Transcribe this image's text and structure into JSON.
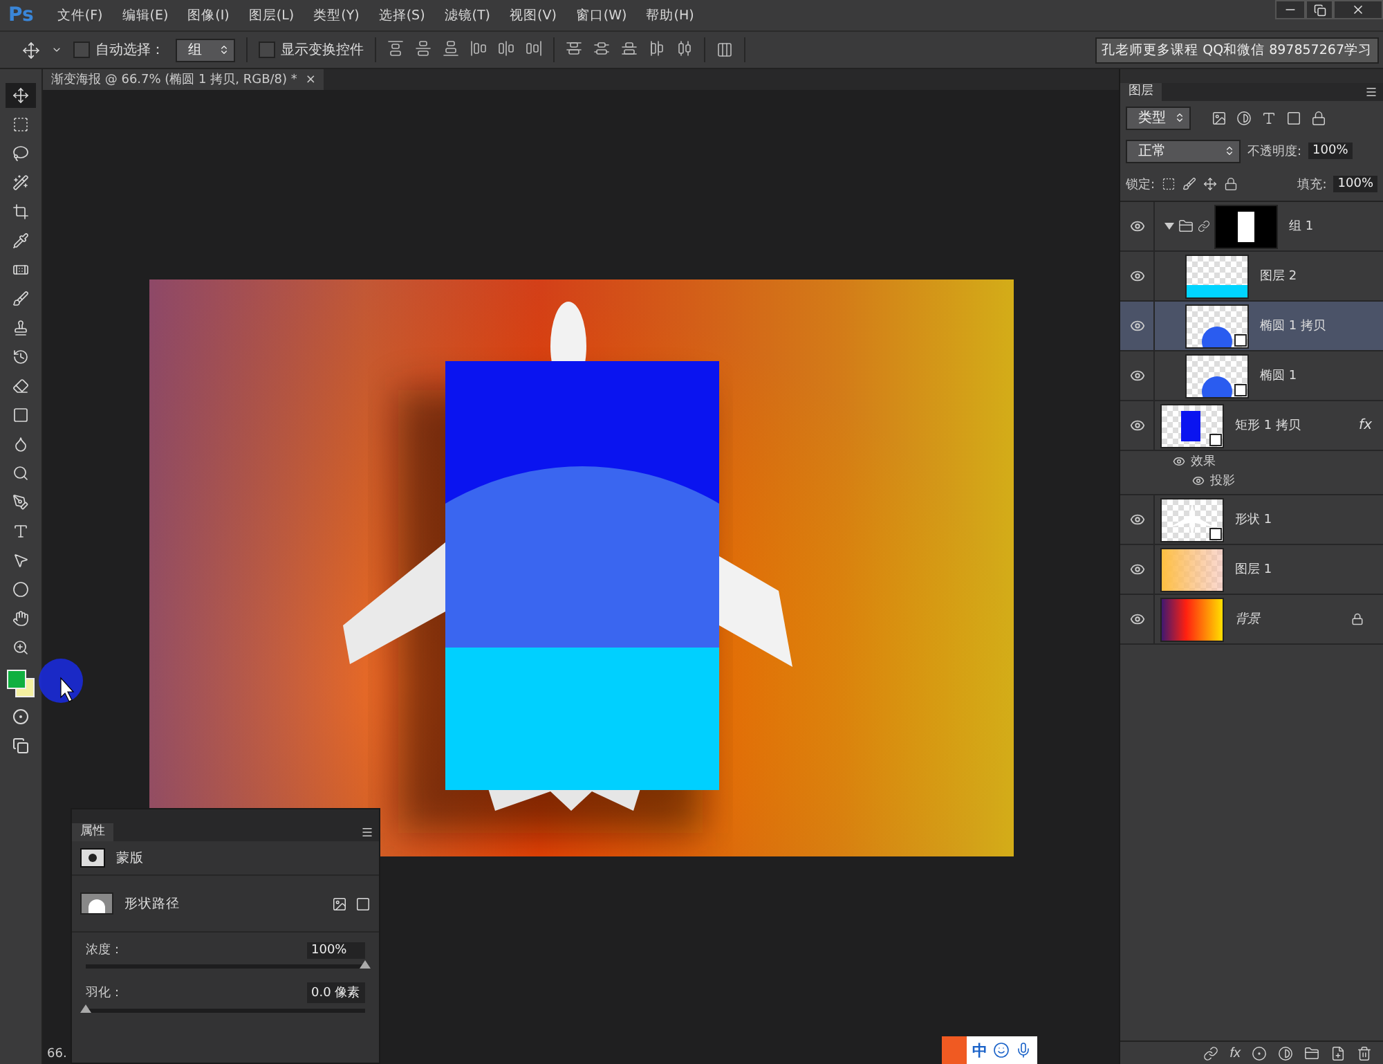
{
  "app_logo": "Ps",
  "menu": [
    "文件(F)",
    "编辑(E)",
    "图像(I)",
    "图层(L)",
    "类型(Y)",
    "选择(S)",
    "滤镜(T)",
    "视图(V)",
    "窗口(W)",
    "帮助(H)"
  ],
  "options": {
    "auto_select": {
      "label": "自动选择：",
      "checked": false
    },
    "target": "组",
    "show_transform": {
      "label": "显示变换控件",
      "checked": false
    },
    "banner": "孔老师更多课程 QQ和微信 897857267学习"
  },
  "tools": [
    {
      "kind": "move",
      "selected": true
    },
    {
      "kind": "marquee",
      "selected": false
    },
    {
      "kind": "lasso",
      "selected": false
    },
    {
      "kind": "quick-select",
      "selected": false
    },
    {
      "kind": "crop",
      "selected": false
    },
    {
      "kind": "eyedropper",
      "selected": false
    },
    {
      "kind": "healing",
      "selected": false
    },
    {
      "kind": "brush",
      "selected": false
    },
    {
      "kind": "stamp",
      "selected": false
    },
    {
      "kind": "history-brush",
      "selected": false
    },
    {
      "kind": "eraser",
      "selected": false
    },
    {
      "kind": "gradient",
      "selected": false
    },
    {
      "kind": "blur",
      "selected": false
    },
    {
      "kind": "dodge",
      "selected": false
    },
    {
      "kind": "pen",
      "selected": false
    },
    {
      "kind": "type",
      "selected": false
    },
    {
      "kind": "path-select",
      "selected": false
    },
    {
      "kind": "ellipse",
      "selected": false
    },
    {
      "kind": "hand",
      "selected": false
    },
    {
      "kind": "zoom",
      "selected": false
    }
  ],
  "document_tab": {
    "title": "渐变海报 @ 66.7% (椭圆 1 拷贝, RGB/8) *",
    "close": "×"
  },
  "status": "66.",
  "layers_panel": {
    "tab": "图层",
    "filter": "类型",
    "blend_mode": "正常",
    "opacity_label": "不透明度:",
    "opacity": "100%",
    "lock_label": "锁定:",
    "fill_label": "填充:",
    "fill": "100%",
    "footer_fx": "fx",
    "layers": [
      {
        "name": "组 1",
        "kind": "group",
        "visible": true,
        "selected": false,
        "expanded": true,
        "children": [
          {
            "name": "图层 2",
            "kind": "layer",
            "visible": true,
            "selected": false
          },
          {
            "name": "椭圆 1 拷贝",
            "kind": "shape",
            "visible": true,
            "selected": true
          },
          {
            "name": "椭圆 1",
            "kind": "shape",
            "visible": true,
            "selected": false
          }
        ]
      },
      {
        "name": "矩形 1 拷贝",
        "kind": "shape",
        "visible": true,
        "selected": false,
        "fx": "fx",
        "effects": {
          "label": "效果",
          "visible": true,
          "children": [
            {
              "label": "投影",
              "visible": true
            }
          ]
        }
      },
      {
        "name": "形状 1",
        "kind": "shape",
        "visible": true,
        "selected": false
      },
      {
        "name": "图层 1",
        "kind": "layer",
        "visible": true,
        "selected": false
      },
      {
        "name": "背景",
        "kind": "background",
        "visible": true,
        "selected": false,
        "locked": true
      }
    ]
  },
  "properties_panel": {
    "tab": "属性",
    "section": "蒙版",
    "path_label": "形状路径",
    "density": {
      "label": "浓度：",
      "value": "100%",
      "level": 1
    },
    "feather": {
      "label": "羽化：",
      "value": "0.0 像素",
      "level": 0
    }
  },
  "ime_bar": {
    "label": "中"
  }
}
